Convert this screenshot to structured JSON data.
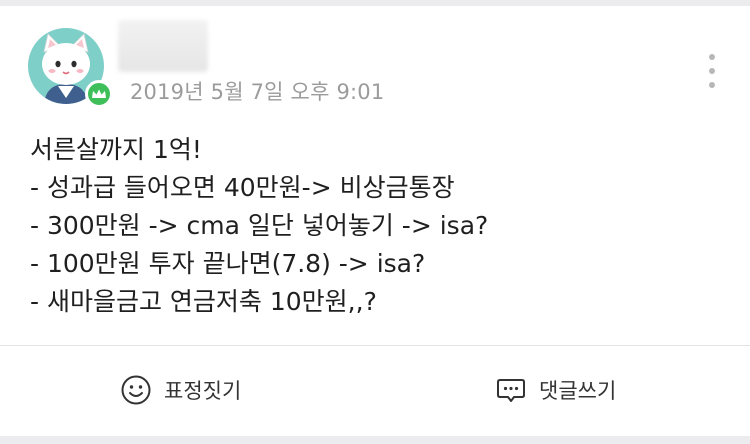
{
  "post": {
    "timestamp": "2019년 5월 7일 오후 9:01",
    "lines": [
      "서른살까지 1억!",
      "- 성과급 들어오면 40만원-> 비상금통장",
      "- 300만원 -> cma 일단 넣어놓기 -> isa?",
      "- 100만원 투자 끝나면(7.8) -> isa?",
      "- 새마을금고 연금저축 10만원,,?"
    ]
  },
  "actions": {
    "react_label": "표정짓기",
    "comment_label": "댓글쓰기"
  },
  "colors": {
    "avatar_bg": "#7fcfc9",
    "badge": "#3fbf5a",
    "timestamp": "#9b9b9b"
  },
  "icons": {
    "badge": "crown-icon",
    "more": "more-vertical-icon",
    "react": "smiley-icon",
    "comment": "comment-bubble-icon"
  }
}
